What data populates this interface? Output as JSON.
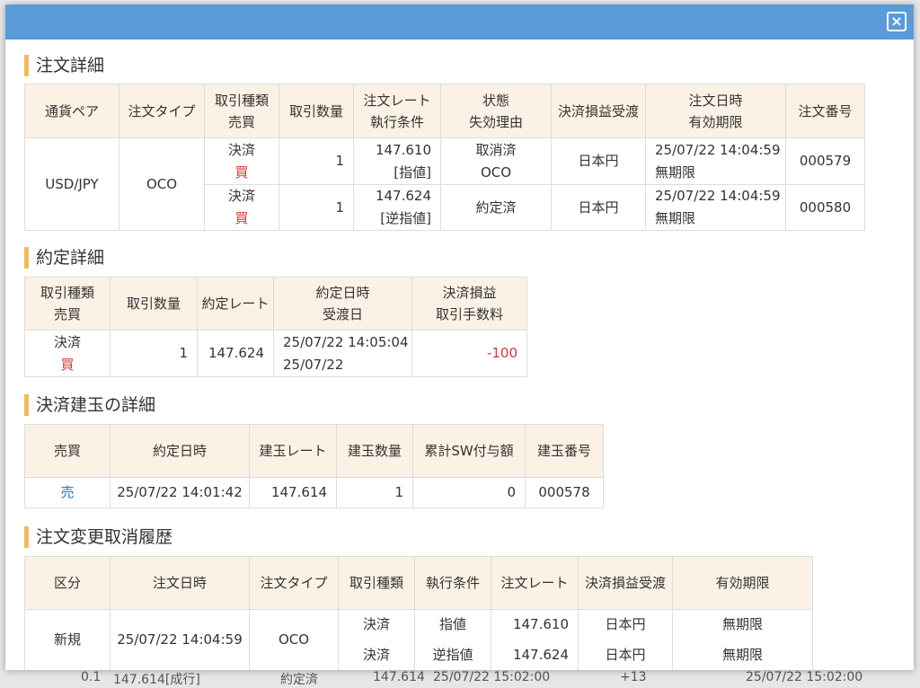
{
  "close_icon": "×",
  "order_detail": {
    "title": "注文詳細",
    "headers": [
      [
        "通貨ペア"
      ],
      [
        "注文タイプ"
      ],
      [
        "取引種類",
        "売買"
      ],
      [
        "取引数量"
      ],
      [
        "注文レート",
        "執行条件"
      ],
      [
        "状態",
        "失効理由"
      ],
      [
        "決済損益受渡"
      ],
      [
        "注文日時",
        "有効期限"
      ],
      [
        "注文番号"
      ]
    ],
    "pair": "USD/JPY",
    "type": "OCO",
    "rows": [
      {
        "kind": "決済",
        "side": "買",
        "qty": "1",
        "rate": "147.610",
        "cond": "[指値]",
        "status": "取消済",
        "reason": "OCO",
        "currency": "日本円",
        "date": "25/07/22 14:04:59",
        "expiry": "無期限",
        "no": "000579"
      },
      {
        "kind": "決済",
        "side": "買",
        "qty": "1",
        "rate": "147.624",
        "cond": "[逆指値]",
        "status": "約定済",
        "reason": "",
        "currency": "日本円",
        "date": "25/07/22 14:04:59",
        "expiry": "無期限",
        "no": "000580"
      }
    ]
  },
  "execution_detail": {
    "title": "約定詳細",
    "headers": [
      [
        "取引種類",
        "売買"
      ],
      [
        "取引数量"
      ],
      [
        "約定レート"
      ],
      [
        "約定日時",
        "受渡日"
      ],
      [
        "決済損益",
        "取引手数料"
      ]
    ],
    "row": {
      "kind": "決済",
      "side": "買",
      "qty": "1",
      "rate": "147.624",
      "date": "25/07/22 14:05:04",
      "delivery": "25/07/22",
      "pl": "-100"
    }
  },
  "position_detail": {
    "title": "決済建玉の詳細",
    "headers": [
      "売買",
      "約定日時",
      "建玉レート",
      "建玉数量",
      "累計SW付与額",
      "建玉番号"
    ],
    "row": {
      "side": "売",
      "date": "25/07/22 14:01:42",
      "rate": "147.614",
      "qty": "1",
      "swap": "0",
      "no": "000578"
    }
  },
  "history": {
    "title": "注文変更取消履歴",
    "headers": [
      "区分",
      "注文日時",
      "注文タイプ",
      "取引種類",
      "執行条件",
      "注文レート",
      "決済損益受渡",
      "有効期限"
    ],
    "category": "新規",
    "date": "25/07/22 14:04:59",
    "type": "OCO",
    "rows": [
      {
        "kind": "決済",
        "cond": "指値",
        "rate": "147.610",
        "currency": "日本円",
        "expiry": "無期限"
      },
      {
        "kind": "決済",
        "cond": "逆指値",
        "rate": "147.624",
        "currency": "日本円",
        "expiry": "無期限"
      }
    ]
  },
  "background": {
    "bottom_row": [
      "0.1",
      "147.614[成行]",
      "約定済",
      "147.614",
      "25/07/22 15:02:00",
      "+13",
      "25/07/22 15:02:00"
    ]
  }
}
